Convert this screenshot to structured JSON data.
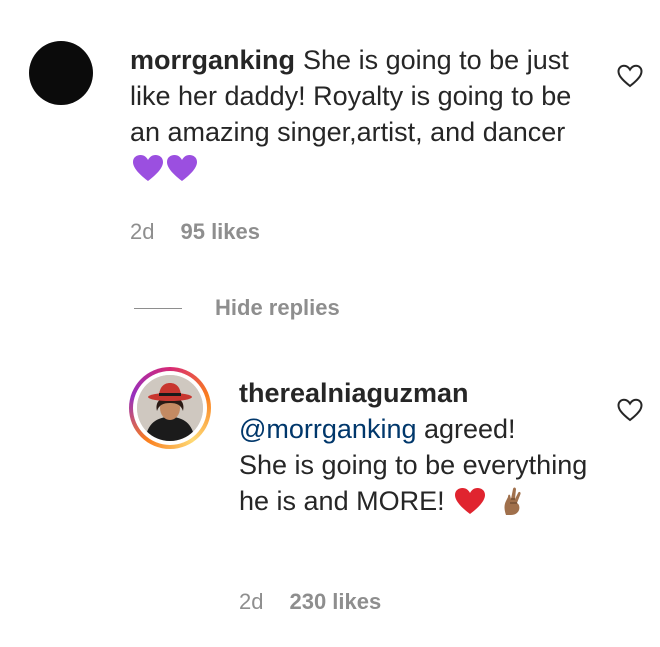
{
  "comment": {
    "username": "morrganking",
    "text": "She is going to be just like her daddy! Royalty is going to be an amazing singer,artist, and dancer",
    "emojis": [
      "purple-heart",
      "purple-heart"
    ],
    "time": "2d",
    "likes": "95 likes"
  },
  "hide_replies_label": "Hide replies",
  "reply": {
    "username": "therealniaguzman",
    "mention": "@morrganking",
    "text_line1": " agreed!",
    "text_rest": "She is going to be everything he is and MORE!",
    "emojis": [
      "red-heart",
      "crossed-fingers"
    ],
    "time": "2d",
    "likes": "230 likes"
  },
  "colors": {
    "text": "#262626",
    "secondary": "#8e8e8e",
    "mention": "#00376b",
    "purple_heart": "#9b4fe0",
    "red_heart": "#e0242f"
  }
}
